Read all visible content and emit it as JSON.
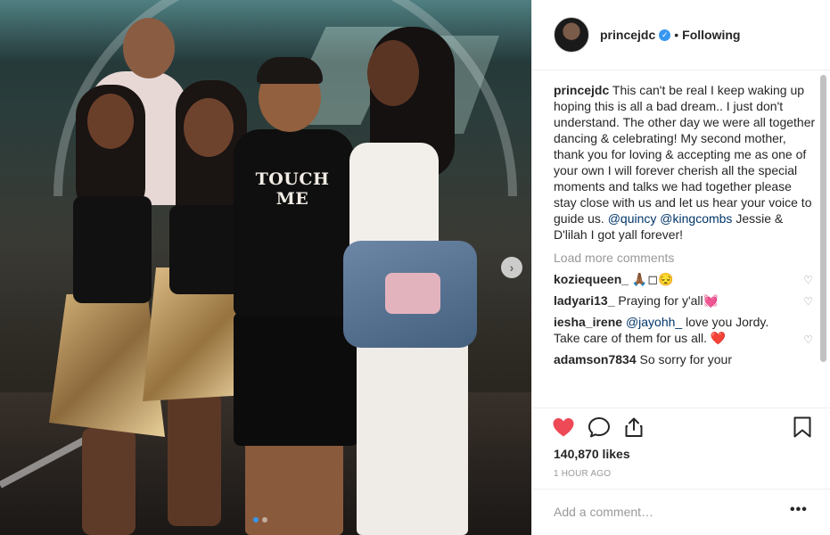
{
  "photo": {
    "alt_desc": "Group photo of five people at a night event",
    "shirt_text": "TOUCH ME",
    "carousel_total": 2,
    "carousel_active": 1
  },
  "header": {
    "username": "princejdc",
    "verified_glyph": "✓",
    "dot": "•",
    "follow_status": "Following"
  },
  "caption": {
    "username": "princejdc",
    "text_part1": "This can't be real I keep waking up hoping this is all a bad dream.. I just don't understand. The other day we were all together dancing & celebrating! My second mother, thank you for loving & accepting me as one of your own I will forever cherish all the special moments and talks we had together please stay close with us and let us hear your voice to guide us.",
    "mention1": "@quincy",
    "mention2": "@kingcombs",
    "text_part2": "Jessie & D'lilah I got yall forever!"
  },
  "load_more": "Load more comments",
  "comments": [
    {
      "username": "koziequeen_",
      "text": "🙏🏾◻😔"
    },
    {
      "username": "ladyari13_",
      "text": "Praying for y'all💓"
    },
    {
      "username": "iesha_irene",
      "mention": "@jayohh_",
      "text": "love you Jordy. Take care of them for us all. ❤️"
    },
    {
      "username": "adamson7834",
      "text": "So sorry for your"
    }
  ],
  "stats": {
    "likes": "140,870 likes",
    "time": "1 HOUR AGO"
  },
  "add_comment": {
    "placeholder": "Add a comment…",
    "more_glyph": "•••"
  },
  "icons": {
    "like": "heart-filled-icon",
    "comment": "speech-bubble-icon",
    "share": "share-icon",
    "save": "bookmark-icon",
    "comment_like": "heart-outline-icon",
    "next": "chevron-right-icon"
  },
  "colors": {
    "like_red": "#ed4956",
    "link_blue": "#003569",
    "verified_blue": "#3897f0",
    "muted": "#999999"
  }
}
